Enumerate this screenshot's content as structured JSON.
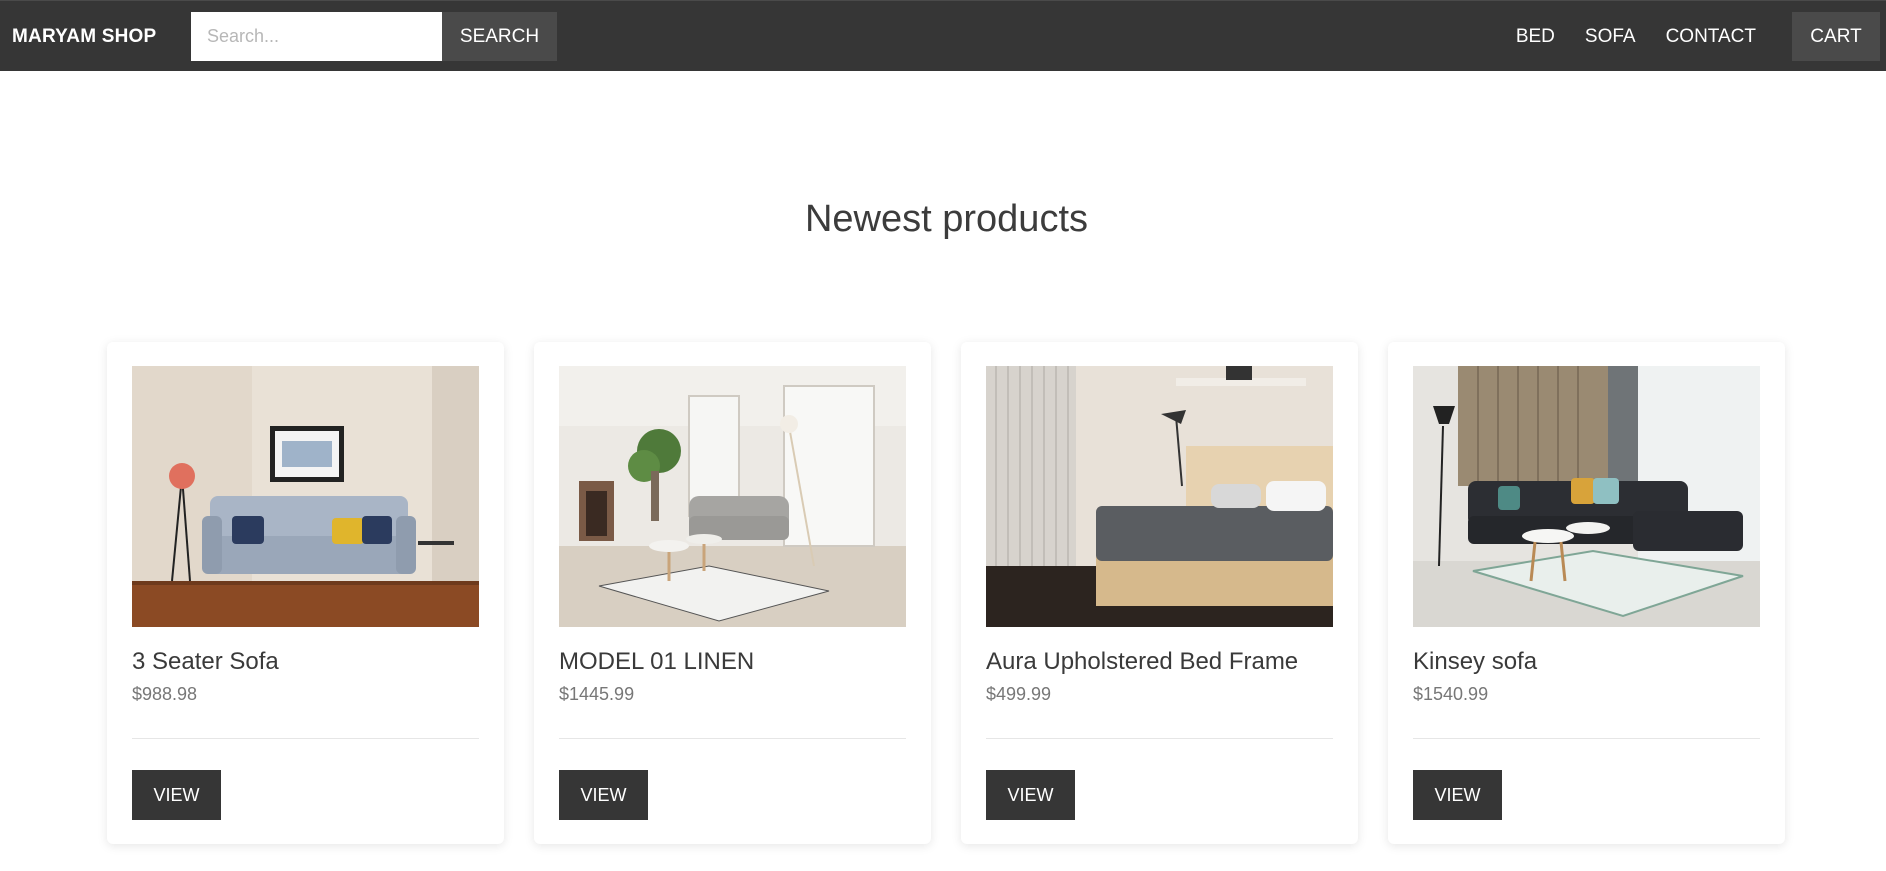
{
  "navbar": {
    "brand": "MARYAM SHOP",
    "search_placeholder": "Search...",
    "search_button": "SEARCH",
    "links": [
      "BED",
      "SOFA",
      "CONTACT"
    ],
    "cart_button": "CART",
    "background_color": "#363636"
  },
  "main": {
    "title": "Newest products",
    "products": [
      {
        "name": "3 Seater Sofa",
        "price": "$988.98",
        "button": "VIEW",
        "image": "sofa-living-room-photo"
      },
      {
        "name": "MODEL 01 LINEN",
        "price": "$1445.99",
        "button": "VIEW",
        "image": "linen-sofa-room-photo"
      },
      {
        "name": "Aura Upholstered Bed Frame",
        "price": "$499.99",
        "button": "VIEW",
        "image": "bed-frame-bedroom-photo"
      },
      {
        "name": "Kinsey sofa",
        "price": "$1540.99",
        "button": "VIEW",
        "image": "corner-sofa-room-photo"
      }
    ]
  }
}
